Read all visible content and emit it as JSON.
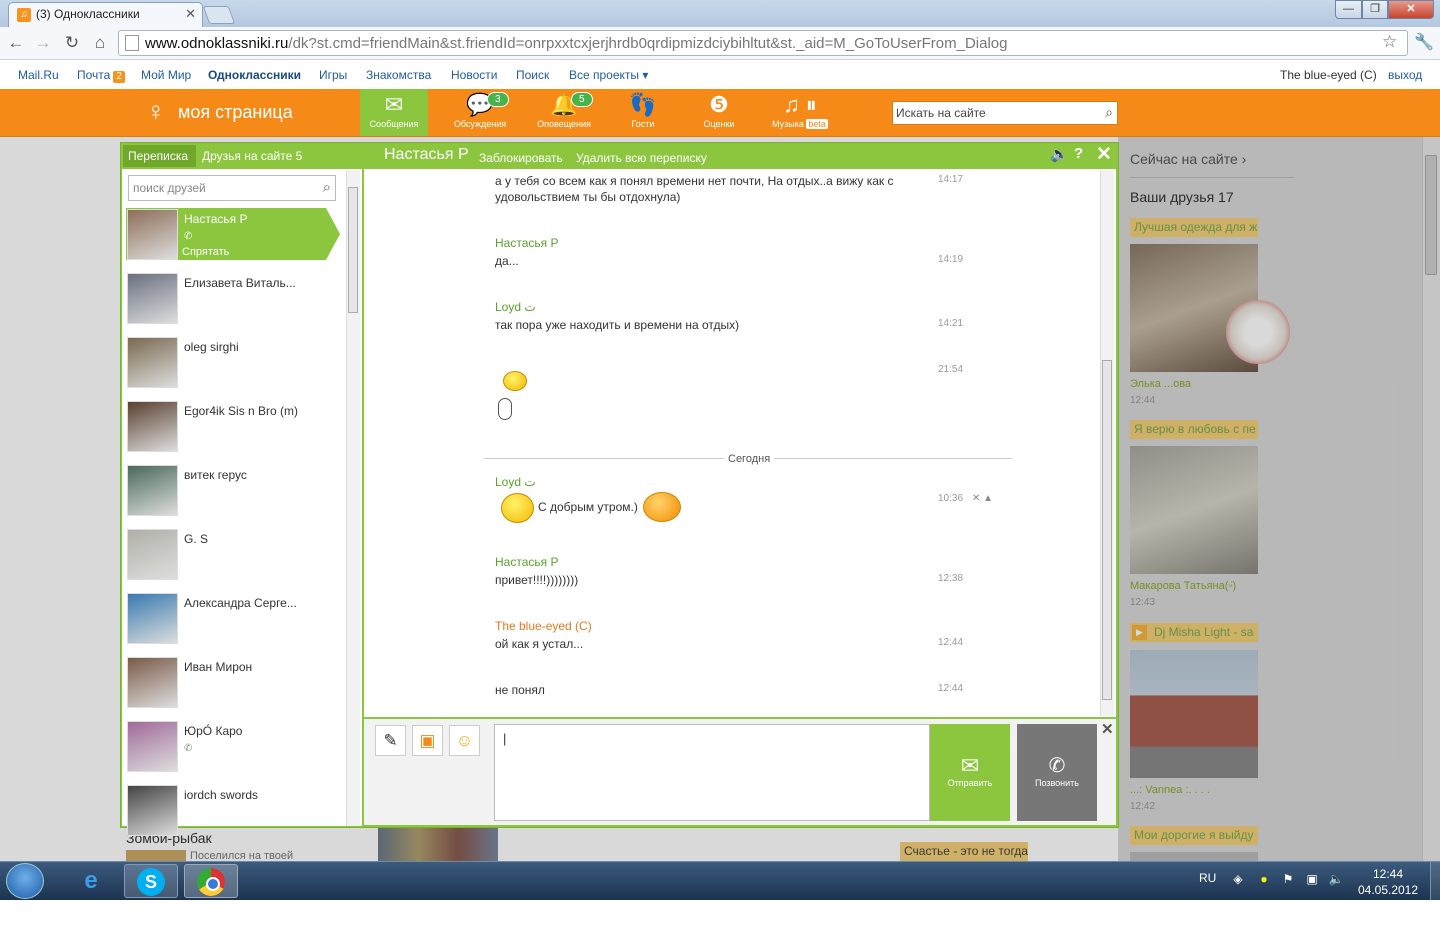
{
  "browser": {
    "tab_title": "(3) Одноклассники",
    "url_domain": "www.odnoklassniki.ru",
    "url_path": "/dk?st.cmd=friendMain&st.friendId=onrpxxtcxjerjhrdb0qrdipmizdciybihltut&st._aid=M_GoToUserFrom_Dialog"
  },
  "toplinks": {
    "items": [
      "Mail.Ru",
      "Почта",
      "Мой Мир",
      "Одноклассники",
      "Игры",
      "Знакомства",
      "Новости",
      "Поиск",
      "Все проекты ▾"
    ],
    "mail_count": "2",
    "user": "The blue-eyed (C)",
    "logout": "выход"
  },
  "header": {
    "my_page": "моя страница",
    "nav": [
      {
        "label": "Сообщения",
        "icon": "envelope-icon",
        "badge": ""
      },
      {
        "label": "Обсуждения",
        "icon": "speech-bubbles-icon",
        "badge": "3"
      },
      {
        "label": "Оповещения",
        "icon": "bell-icon",
        "badge": "5"
      },
      {
        "label": "Гости",
        "icon": "footprints-icon",
        "badge": ""
      },
      {
        "label": "Оценки",
        "icon": "five-rating-icon",
        "badge": ""
      },
      {
        "label": "Музыка",
        "icon": "music-note-icon",
        "badge": "beta"
      }
    ],
    "search_placeholder": "Искать на сайте"
  },
  "chat": {
    "tab_correspondence": "Переписка",
    "tab_friends_online": "Друзья на сайте 5",
    "contact_name": "Настасья Р",
    "block": "Заблокировать",
    "delete_all": "Удалить всю переписку",
    "friend_search_placeholder": "поиск друзей",
    "hide_label": "Спрятать",
    "friends": [
      {
        "name": "Настасья Р",
        "phone": true,
        "selected": true,
        "color": "#8d6e58"
      },
      {
        "name": "Елизавета Виталь...",
        "phone": false,
        "color": "#6a7080"
      },
      {
        "name": "oleg sirghi",
        "phone": false,
        "color": "#7a6a50"
      },
      {
        "name": "Egor4ik Sis n Bro (m)",
        "phone": false,
        "color": "#5a4030"
      },
      {
        "name": "витек герус",
        "phone": false,
        "color": "#4a6a5a"
      },
      {
        "name": "G. S",
        "phone": false,
        "color": "#b0b0a8"
      },
      {
        "name": "Александра Серге...",
        "phone": false,
        "color": "#3a7ab0"
      },
      {
        "name": "Иван Мирон",
        "phone": false,
        "color": "#7a5a48"
      },
      {
        "name": "ЮрО́ Каро",
        "phone": true,
        "color": "#a06a9a"
      },
      {
        "name": "iordch swords",
        "phone": false,
        "color": "#444444"
      }
    ],
    "messages": [
      {
        "author": "",
        "text": "а у тебя со всем как я понял времени нет почти, На отдых..а вижу как с удовольствием ты бы отдохнула)",
        "time": "14:17"
      },
      {
        "author": "Настасья Р",
        "text": "да...",
        "time": "14:19"
      },
      {
        "author": "Loyd ت",
        "text": "так пора уже находить и времени на отдых)",
        "time": "14:21"
      },
      {
        "author": "",
        "text": "",
        "time": "21:54"
      },
      {
        "author": "Loyd ت",
        "text": "С добрым утром.)",
        "time": "10:36"
      },
      {
        "author": "Настасья Р",
        "text": "привет!!!!))))))))",
        "time": "12:38"
      },
      {
        "author": "The blue-eyed (C)",
        "text": "ой как я устал...",
        "time": "12:44"
      },
      {
        "author": "",
        "text": "не понял",
        "time": "12:44"
      }
    ],
    "day_separator": "Сегодня",
    "send_label": "Отправить",
    "call_label": "Позвонить"
  },
  "background": {
    "now_online": "Сейчас на сайте ›",
    "your_friends": "Ваши друзья 17",
    "cards": [
      {
        "caption": "Лучшая одежда для ж",
        "name": "Элька ...ова",
        "time": "12:44"
      },
      {
        "caption": "Я верю в любовь с пе",
        "name": "Макарова Татьяна(ᵕ̈)",
        "time": "12:43"
      },
      {
        "caption": "Dj Misha Light - sa",
        "name": "...: Vannea :. . . .",
        "time": "12:42"
      },
      {
        "caption": "Мои дорогие я выйду",
        "name": "",
        "time": ""
      }
    ],
    "game_title": "Зомби-рыбак",
    "game_sub": "Поселился на твоей",
    "happiness": "Счастье - это не тогда"
  },
  "taskbar": {
    "lang": "RU",
    "time": "12:44",
    "date": "04.05.2012"
  }
}
